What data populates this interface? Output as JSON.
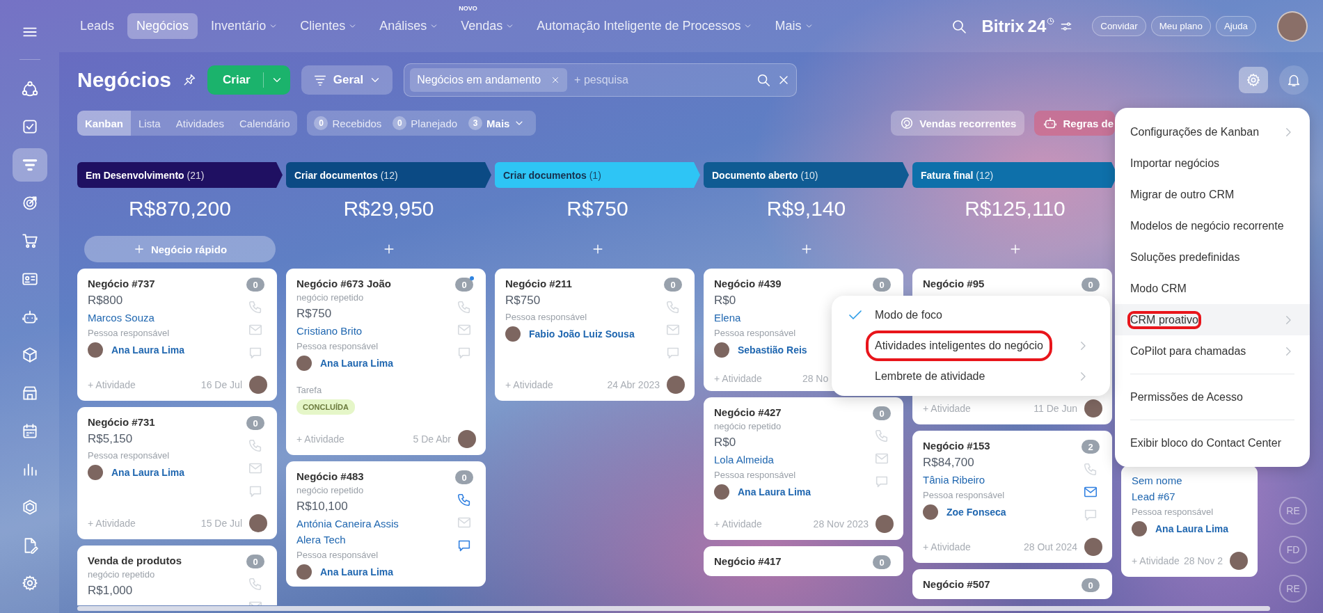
{
  "nav": {
    "items": [
      {
        "label": "Leads",
        "selected": false,
        "dropdown": false
      },
      {
        "label": "Negócios",
        "selected": true,
        "dropdown": false
      },
      {
        "label": "Inventário",
        "selected": false,
        "dropdown": true
      },
      {
        "label": "Clientes",
        "selected": false,
        "dropdown": true
      },
      {
        "label": "Análises",
        "selected": false,
        "dropdown": true
      },
      {
        "label": "Vendas",
        "selected": false,
        "dropdown": true,
        "badge": "NOVO"
      },
      {
        "label": "Automação Inteligente de Processos",
        "selected": false,
        "dropdown": true
      },
      {
        "label": "Mais",
        "selected": false,
        "dropdown": true
      }
    ],
    "brand": "Bitrix",
    "brand_number": "24",
    "buttons": [
      "Convidar",
      "Meu plano",
      "Ajuda"
    ]
  },
  "sidebar": {
    "items": [
      {
        "kind": "network",
        "selected": false
      },
      {
        "kind": "task",
        "selected": false
      },
      {
        "kind": "funnel",
        "selected": true
      },
      {
        "kind": "target",
        "selected": false
      },
      {
        "kind": "cart",
        "selected": false
      },
      {
        "kind": "card",
        "selected": false
      },
      {
        "kind": "robot",
        "selected": false
      },
      {
        "kind": "box",
        "selected": false
      },
      {
        "kind": "store",
        "selected": false
      },
      {
        "kind": "calendar",
        "selected": false
      },
      {
        "kind": "chart",
        "selected": false
      },
      {
        "kind": "hexagon",
        "selected": false
      },
      {
        "kind": "doc",
        "selected": false
      }
    ],
    "footer_items": [
      {
        "kind": "settings",
        "selected": false
      }
    ]
  },
  "toolbar": {
    "title": "Negócios",
    "create_label": "Criar",
    "preset_label": "Geral",
    "search_chip": "Negócios em andamento",
    "search_placeholder": "+ pesquisa",
    "settings_active": true,
    "views": [
      {
        "label": "Kanban",
        "selected": true
      },
      {
        "label": "Lista",
        "selected": false
      },
      {
        "label": "Atividades",
        "selected": false
      },
      {
        "label": "Calendário",
        "selected": false
      }
    ],
    "counters": [
      {
        "count": "0",
        "label": "Recebidos",
        "dropdown": false
      },
      {
        "count": "0",
        "label": "Planejado",
        "dropdown": false
      },
      {
        "count": "3",
        "label": "Mais",
        "dropdown": true
      }
    ],
    "actions": [
      {
        "kind": "recurring",
        "label": "Vendas recorrentes"
      },
      {
        "kind": "robot",
        "label": "Regras de"
      }
    ]
  },
  "columns": [
    {
      "kind": "stage",
      "title": "Em Desenvolvimento",
      "count": "(21)",
      "color": "#1f1062",
      "total": "R$870,200",
      "add_label": "Negócio rápido",
      "cards": [
        {
          "title": "Negócio #737",
          "counter": "0",
          "notified": false,
          "amount": "R$800",
          "contacts": [
            "Marcos Souza"
          ],
          "responsible_label": "Pessoa responsável",
          "responsible": "Ana Laura Lima",
          "channels": [
            {
              "kind": "phone",
              "active": false
            },
            {
              "kind": "mail",
              "active": false
            },
            {
              "kind": "chat",
              "active": false
            }
          ],
          "activity": "+ Atividade",
          "date": "16 De Jul"
        },
        {
          "title": "Negócio #731",
          "counter": "0",
          "notified": false,
          "amount": "R$5,150",
          "responsible_label": "Pessoa responsável",
          "responsible": "Ana Laura Lima",
          "channels": [
            {
              "kind": "phone",
              "active": false
            },
            {
              "kind": "mail",
              "active": false
            },
            {
              "kind": "chat",
              "active": false
            }
          ],
          "activity": "+ Atividade",
          "date": "15 De Jul"
        },
        {
          "title": "Venda de produtos",
          "counter": "0",
          "notified": false,
          "subtitle": "negócio repetido",
          "amount": "R$1,000",
          "channels": [
            {
              "kind": "phone",
              "active": false
            },
            {
              "kind": "mail",
              "active": false
            }
          ]
        }
      ]
    },
    {
      "kind": "stage",
      "title": "Criar documentos",
      "count": "(12)",
      "color": "#0b4a84",
      "total": "R$29,950",
      "cards": [
        {
          "title": "Negócio #673 João",
          "counter": "0",
          "notified": true,
          "subtitle": "negócio repetido",
          "amount": "R$750",
          "contacts": [
            "Cristiano Brito"
          ],
          "responsible_label": "Pessoa responsável",
          "responsible": "Ana Laura Lima",
          "task_label": "Tarefa",
          "badge": "CONCLUÍDA",
          "channels": [
            {
              "kind": "phone",
              "active": false
            },
            {
              "kind": "mail",
              "active": false
            },
            {
              "kind": "chat",
              "active": false
            }
          ],
          "activity": "+ Atividade",
          "date": "5 De Abr"
        },
        {
          "title": "Negócio #483",
          "counter": "0",
          "notified": false,
          "subtitle": "negócio repetido",
          "amount": "R$10,100",
          "contacts": [
            "Antónia Caneira Assis",
            "Alera Tech"
          ],
          "responsible_label": "Pessoa responsável",
          "responsible": "Ana Laura Lima",
          "channels": [
            {
              "kind": "phone",
              "active": true
            },
            {
              "kind": "mail",
              "active": false
            },
            {
              "kind": "chat",
              "active": true
            }
          ]
        }
      ]
    },
    {
      "kind": "stage",
      "title": "Criar documentos",
      "count": "(1)",
      "color": "#2ec5f5",
      "total": "R$750",
      "cards": [
        {
          "title": "Negócio #211",
          "counter": "0",
          "notified": false,
          "amount": "R$750",
          "responsible_label": "Pessoa responsável",
          "responsible": "Fabio João Luiz Sousa",
          "channels": [
            {
              "kind": "phone",
              "active": false
            },
            {
              "kind": "mail",
              "active": false
            },
            {
              "kind": "chat",
              "active": false
            }
          ],
          "activity": "+ Atividade",
          "date": "24 Abr 2023"
        }
      ]
    },
    {
      "kind": "stage",
      "title": "Documento aberto",
      "count": "(10)",
      "color": "#0f5b93",
      "total": "R$9,140",
      "cards": [
        {
          "title": "Negócio #439",
          "counter": "0",
          "notified": false,
          "covered_right": true,
          "amount": "R$0",
          "contacts": [
            "Elena"
          ],
          "responsible_label": "Pessoa responsável",
          "responsible": "Sebastião Reis",
          "activity": "+ Atividade",
          "date": "28 No"
        },
        {
          "title": "Negócio #427",
          "counter": "0",
          "notified": false,
          "subtitle": "negócio repetido",
          "amount": "R$0",
          "contacts": [
            "Lola Almeida"
          ],
          "responsible_label": "Pessoa responsável",
          "responsible": "Ana Laura Lima",
          "channels": [
            {
              "kind": "phone",
              "active": false
            },
            {
              "kind": "mail",
              "active": false
            },
            {
              "kind": "chat",
              "active": false
            }
          ],
          "activity": "+ Atividade",
          "date": "28 Nov 2023"
        },
        {
          "title": "Negócio #417",
          "counter": "0",
          "notified": false
        }
      ]
    },
    {
      "kind": "stage",
      "title": "Fatura final",
      "count": "(12)",
      "color": "#0e70aa",
      "total": "R$125,110",
      "cards": [
        {
          "title": "Negócio #95",
          "counter": "0",
          "notified": false,
          "covered_middle": true,
          "activity": "+ Atividade",
          "date": "11 De Jun"
        },
        {
          "title": "Negócio #153",
          "counter": "2",
          "notified": false,
          "amount": "R$84,700",
          "contacts": [
            "Tânia Ribeiro"
          ],
          "responsible_label": "Pessoa responsável",
          "responsible": "Zoe Fonseca",
          "channels": [
            {
              "kind": "phone",
              "active": false
            },
            {
              "kind": "mail",
              "active": true
            },
            {
              "kind": "chat",
              "active": false
            }
          ],
          "activity": "+ Atividade",
          "date": "28 Out 2024"
        },
        {
          "title": "Negócio #507",
          "counter": "0",
          "notified": false
        }
      ]
    },
    {
      "kind": "covered",
      "cards": [
        {
          "contacts": [
            "Sem nome",
            "Lead #67"
          ],
          "responsible_label": "Pessoa responsável",
          "responsible": "Ana Laura Lima",
          "activity": "+ Atividade",
          "date": "28 Nov 2"
        }
      ]
    }
  ],
  "avatar_strip": [
    "RE",
    "FD",
    "RE"
  ],
  "settings_menu": {
    "items": [
      {
        "kind": "item",
        "label": "Configurações de Kanban",
        "submenu": true,
        "selected": false,
        "highlighted": false
      },
      {
        "kind": "item",
        "label": "Importar negócios",
        "submenu": false,
        "selected": false,
        "highlighted": false
      },
      {
        "kind": "item",
        "label": "Migrar de outro CRM",
        "submenu": false,
        "selected": false,
        "highlighted": false
      },
      {
        "kind": "item",
        "label": "Modelos de negócio recorrente",
        "submenu": false,
        "selected": false,
        "highlighted": false
      },
      {
        "kind": "item",
        "label": "Soluções predefinidas",
        "submenu": false,
        "selected": false,
        "highlighted": false
      },
      {
        "kind": "item",
        "label": "Modo CRM",
        "submenu": false,
        "selected": false,
        "highlighted": false
      },
      {
        "kind": "item",
        "label": "CRM proativo",
        "submenu": true,
        "selected": true,
        "highlighted": true
      },
      {
        "kind": "item",
        "label": "CoPilot para chamadas",
        "submenu": true,
        "selected": false,
        "highlighted": false
      },
      {
        "kind": "divider"
      },
      {
        "kind": "item",
        "label": "Permissões de Acesso",
        "submenu": false,
        "selected": false,
        "highlighted": false
      },
      {
        "kind": "divider"
      },
      {
        "kind": "item",
        "label": "Exibir bloco do Contact Center",
        "submenu": false,
        "selected": false,
        "highlighted": false
      }
    ]
  },
  "submenu": {
    "items": [
      {
        "label": "Modo de foco",
        "checked": true,
        "submenu": false,
        "highlighted": false
      },
      {
        "label": "Atividades inteligentes do negócio",
        "checked": false,
        "submenu": true,
        "highlighted": true
      },
      {
        "label": "Lembrete de atividade",
        "checked": false,
        "submenu": true,
        "highlighted": false
      }
    ]
  }
}
